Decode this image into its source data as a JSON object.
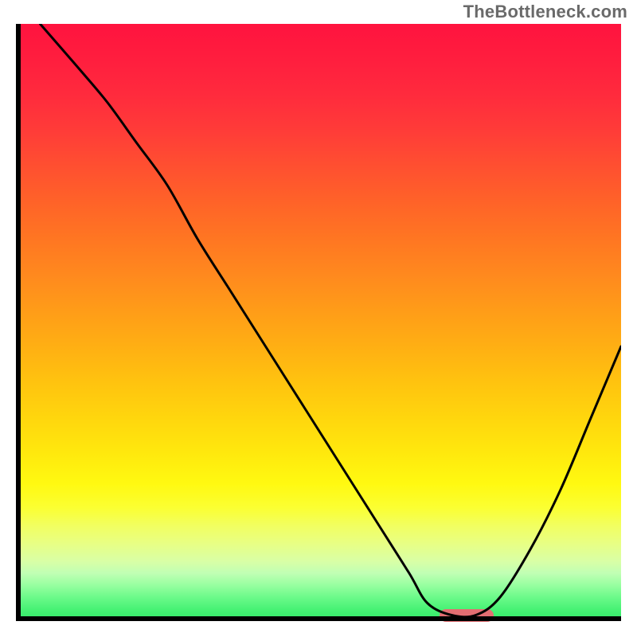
{
  "watermark": {
    "text": "TheBottleneck.com"
  },
  "chart_data": {
    "type": "line",
    "title": "",
    "xlabel": "",
    "ylabel": "",
    "xlim": [
      0,
      100
    ],
    "ylim": [
      0,
      100
    ],
    "grid": false,
    "legend": false,
    "series": [
      {
        "name": "bottleneck-curve",
        "color": "#000000",
        "x": [
          4,
          10,
          15,
          20,
          25,
          30,
          35,
          40,
          45,
          50,
          55,
          60,
          65,
          68,
          72,
          76,
          80,
          85,
          90,
          95,
          100
        ],
        "y": [
          100,
          93,
          87,
          80,
          73,
          64,
          56,
          48,
          40,
          32,
          24,
          16,
          8,
          3,
          1,
          1,
          4,
          12,
          22,
          34,
          46
        ]
      }
    ],
    "marker": {
      "name": "optimal-range",
      "color": "#e26e72",
      "x_start": 70,
      "x_end": 79,
      "y": 1
    },
    "background_gradient": {
      "stops": [
        {
          "pos": 0,
          "color": "#ff133f"
        },
        {
          "pos": 50,
          "color": "#ff9c18"
        },
        {
          "pos": 77,
          "color": "#fff911"
        },
        {
          "pos": 100,
          "color": "#31e968"
        }
      ]
    }
  }
}
